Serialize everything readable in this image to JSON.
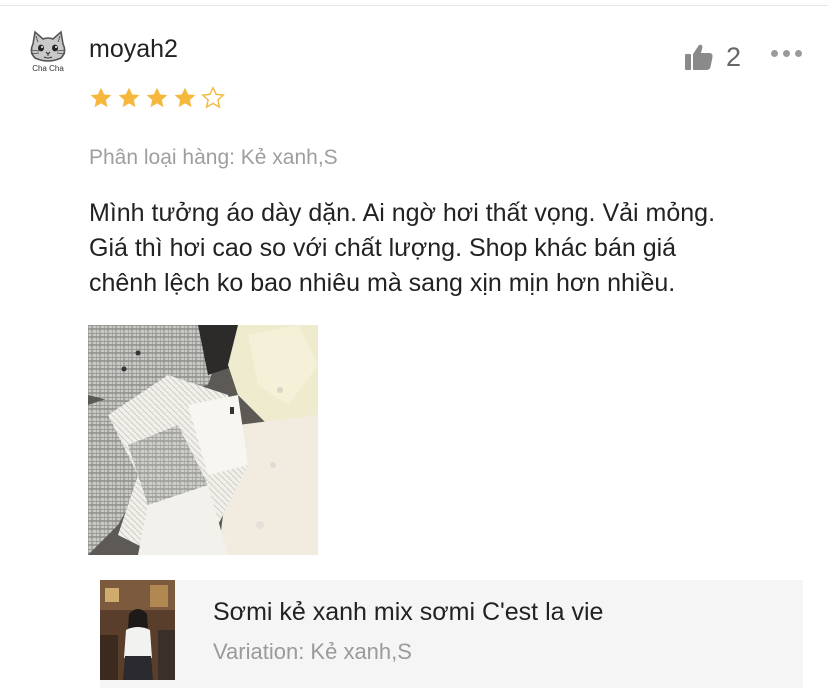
{
  "review": {
    "avatar_tag": "Cha Cha",
    "username": "moyah2",
    "rating": 4,
    "rating_max": 5,
    "like_count": "2",
    "variation": "Phân loại hàng: Kẻ xanh,S",
    "comment_lines": [
      "Mình tưởng áo dày dặn. Ai ngờ hơi thất vọng. Vải mỏng.",
      "Giá thì hơi cao so với chất lượng. Shop khác bán giá",
      "chênh lệch ko bao nhiêu mà sang xịn mịn hơn nhiều."
    ]
  },
  "product": {
    "name": "Sơmi kẻ xanh mix sơmi C'est la vie",
    "variation": "Variation: Kẻ xanh,S"
  },
  "colors": {
    "star": "#f5b83d",
    "star_empty_stroke": "#f5b83d",
    "text": "#222222",
    "muted": "#9e9e9e",
    "card_bg": "#f5f5f5"
  },
  "icons": {
    "avatar": "cat-face-icon",
    "like": "thumbs-up-icon",
    "more": "more-dots-icon",
    "star_full": "star-filled-icon",
    "star_empty": "star-outline-icon"
  }
}
